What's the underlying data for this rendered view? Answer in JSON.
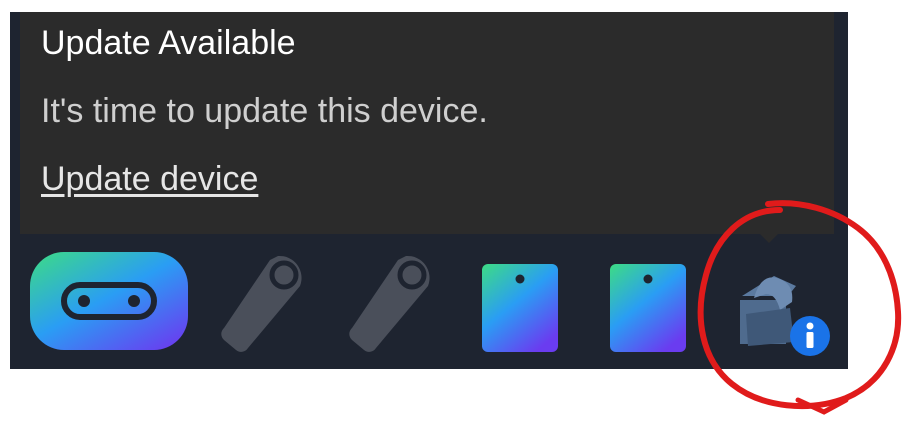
{
  "notification": {
    "title": "Update Available",
    "message": "It's time to update this device.",
    "action_link": "Update device"
  },
  "tray": {
    "icons": [
      {
        "name": "microbit-device-icon"
      },
      {
        "name": "stylus-pen-icon"
      },
      {
        "name": "stylus-pen-icon"
      },
      {
        "name": "tablet-device-icon"
      },
      {
        "name": "tablet-device-icon"
      },
      {
        "name": "device-update-info-icon"
      }
    ]
  },
  "colors": {
    "app_bg": "#1e2430",
    "popup_bg": "#2b2b2b",
    "gradient_start": "#3ddc84",
    "gradient_mid": "#2a9df4",
    "gradient_end": "#6a3cf0",
    "pen_gray": "#4a4f5a",
    "info_blue": "#1a73e8",
    "annotation_red": "#e01b1b"
  }
}
